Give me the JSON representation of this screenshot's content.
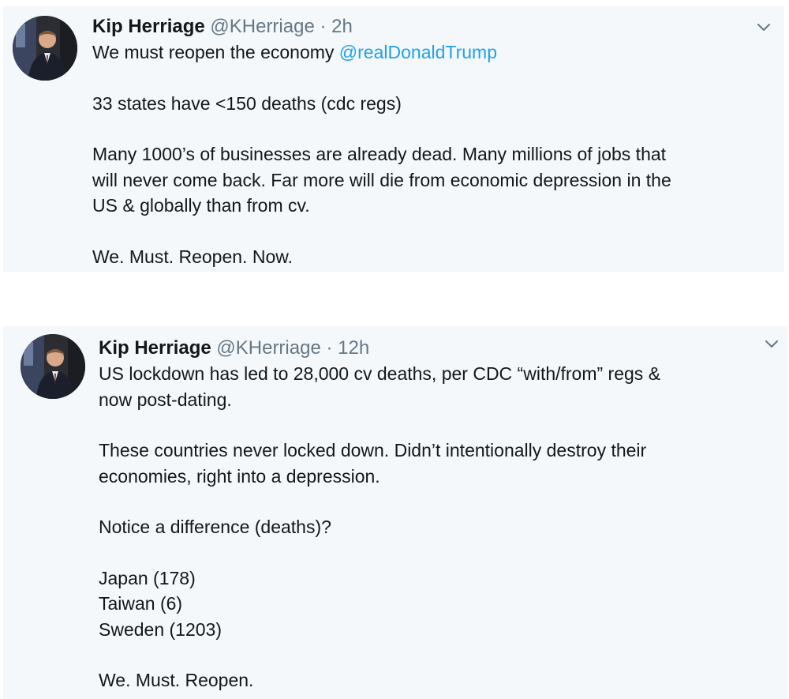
{
  "colors": {
    "card_background": "#f5f8fa",
    "text": "#14171a",
    "secondary_text": "#657786",
    "link": "#1da1f2"
  },
  "tweets": [
    {
      "author_name": "Kip Herriage",
      "handle": "@KHerriage",
      "separator": "·",
      "time": "2h",
      "avatar_icon": "profile-photo",
      "menu_icon": "chevron-down-icon",
      "line1_text": "We must reopen the economy ",
      "line1_mention": "@realDonaldTrump",
      "para2": "33 states have <150 deaths (cdc regs)",
      "para3_lines": [
        "Many 1000’s of businesses are already dead. Many millions of jobs that",
        "will never come back. Far more will die from economic depression in the",
        "US & globally than from cv."
      ],
      "para4": "We. Must. Reopen. Now."
    },
    {
      "author_name": "Kip Herriage",
      "handle": "@KHerriage",
      "separator": "·",
      "time": "12h",
      "avatar_icon": "profile-photo",
      "menu_icon": "chevron-down-icon",
      "para1_lines": [
        "US lockdown has led to 28,000 cv deaths, per CDC “with/from” regs &",
        "now post-dating."
      ],
      "para2_lines": [
        "These countries never locked down. Didn’t intentionally destroy their",
        "economies, right into a depression."
      ],
      "para3": "Notice a difference (deaths)?",
      "country_lines": [
        "Japan (178)",
        "Taiwan (6)",
        "Sweden (1203)"
      ],
      "para5": "We. Must. Reopen."
    }
  ]
}
